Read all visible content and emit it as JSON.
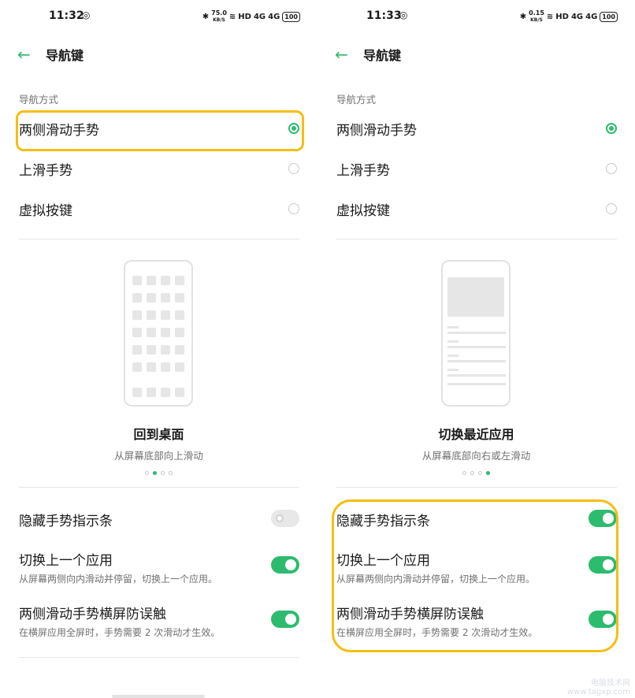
{
  "left": {
    "time": "11:32",
    "net_speed": "75.0",
    "net_unit": "KB/S",
    "header": {
      "title": "导航键"
    },
    "section_label": "导航方式",
    "options": [
      {
        "label": "两侧滑动手势",
        "selected": true
      },
      {
        "label": "上滑手势",
        "selected": false
      },
      {
        "label": "虚拟按键",
        "selected": false
      }
    ],
    "demo": {
      "title": "回到桌面",
      "subtitle": "从屏幕底部向上滑动",
      "page_index": 2,
      "page_count": 4
    },
    "toggles": [
      {
        "title": "隐藏手势指示条",
        "subtitle": "",
        "on": false
      },
      {
        "title": "切换上一个应用",
        "subtitle": "从屏幕两侧向内滑动并停留，切换上一个应用。",
        "on": true
      },
      {
        "title": "两侧滑动手势横屏防误触",
        "subtitle": "在横屏应用全屏时，手势需要 2 次滑动才生效。",
        "on": true
      }
    ]
  },
  "right": {
    "time": "11:33",
    "net_speed": "0.15",
    "net_unit": "KB/S",
    "header": {
      "title": "导航键"
    },
    "section_label": "导航方式",
    "options": [
      {
        "label": "两侧滑动手势",
        "selected": true
      },
      {
        "label": "上滑手势",
        "selected": false
      },
      {
        "label": "虚拟按键",
        "selected": false
      }
    ],
    "demo": {
      "title": "切换最近应用",
      "subtitle": "从屏幕底部向右或左滑动",
      "page_index": 4,
      "page_count": 4
    },
    "toggles": [
      {
        "title": "隐藏手势指示条",
        "subtitle": "",
        "on": true
      },
      {
        "title": "切换上一个应用",
        "subtitle": "从屏幕两侧向内滑动并停留，切换上一个应用。",
        "on": true
      },
      {
        "title": "两侧滑动手势横屏防误触",
        "subtitle": "在横屏应用全屏时，手势需要 2 次滑动才生效。",
        "on": true
      }
    ]
  },
  "status_labels": {
    "hd": "HD",
    "signal": "4G",
    "battery": "100"
  },
  "colors": {
    "accent": "#2dbb6e",
    "highlight": "#f5be12"
  },
  "watermark": {
    "line1": "电脑技术网",
    "line2": "www.tagxp.com"
  }
}
